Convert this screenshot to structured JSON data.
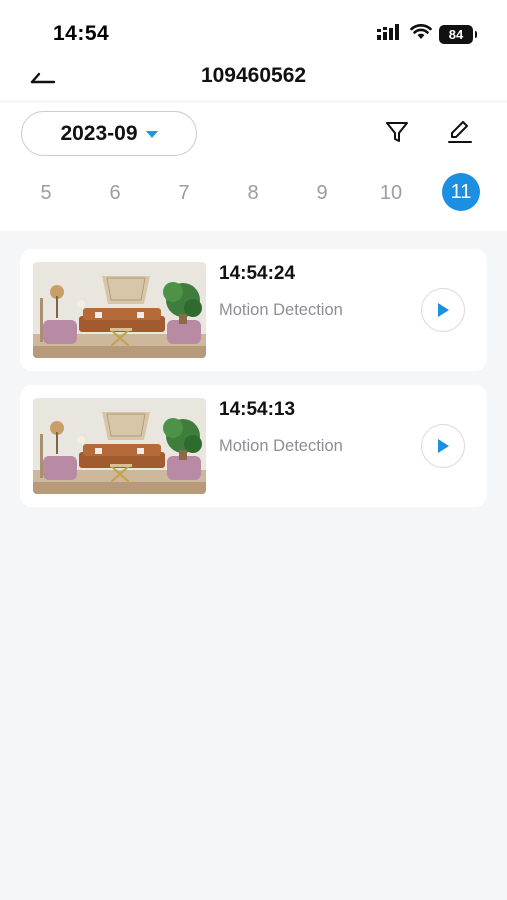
{
  "status_bar": {
    "time": "14:54",
    "battery": "84",
    "icons": [
      "signal-icon",
      "wifi-icon",
      "battery-icon"
    ]
  },
  "nav": {
    "back_icon": "back-arrow-icon",
    "title": "109460562"
  },
  "filter": {
    "month": "2023-09",
    "filter_icon": "filter-icon",
    "edit_icon": "edit-icon"
  },
  "days": [
    {
      "label": "5",
      "active": false
    },
    {
      "label": "6",
      "active": false
    },
    {
      "label": "7",
      "active": false
    },
    {
      "label": "8",
      "active": false
    },
    {
      "label": "9",
      "active": false
    },
    {
      "label": "10",
      "active": false
    },
    {
      "label": "11",
      "active": true
    }
  ],
  "events": [
    {
      "time": "14:54:24",
      "type": "Motion Detection"
    },
    {
      "time": "14:54:13",
      "type": "Motion Detection"
    }
  ],
  "colors": {
    "accent": "#1d8fe0",
    "background": "#f4f6f8",
    "muted_text": "#8c8f95"
  }
}
